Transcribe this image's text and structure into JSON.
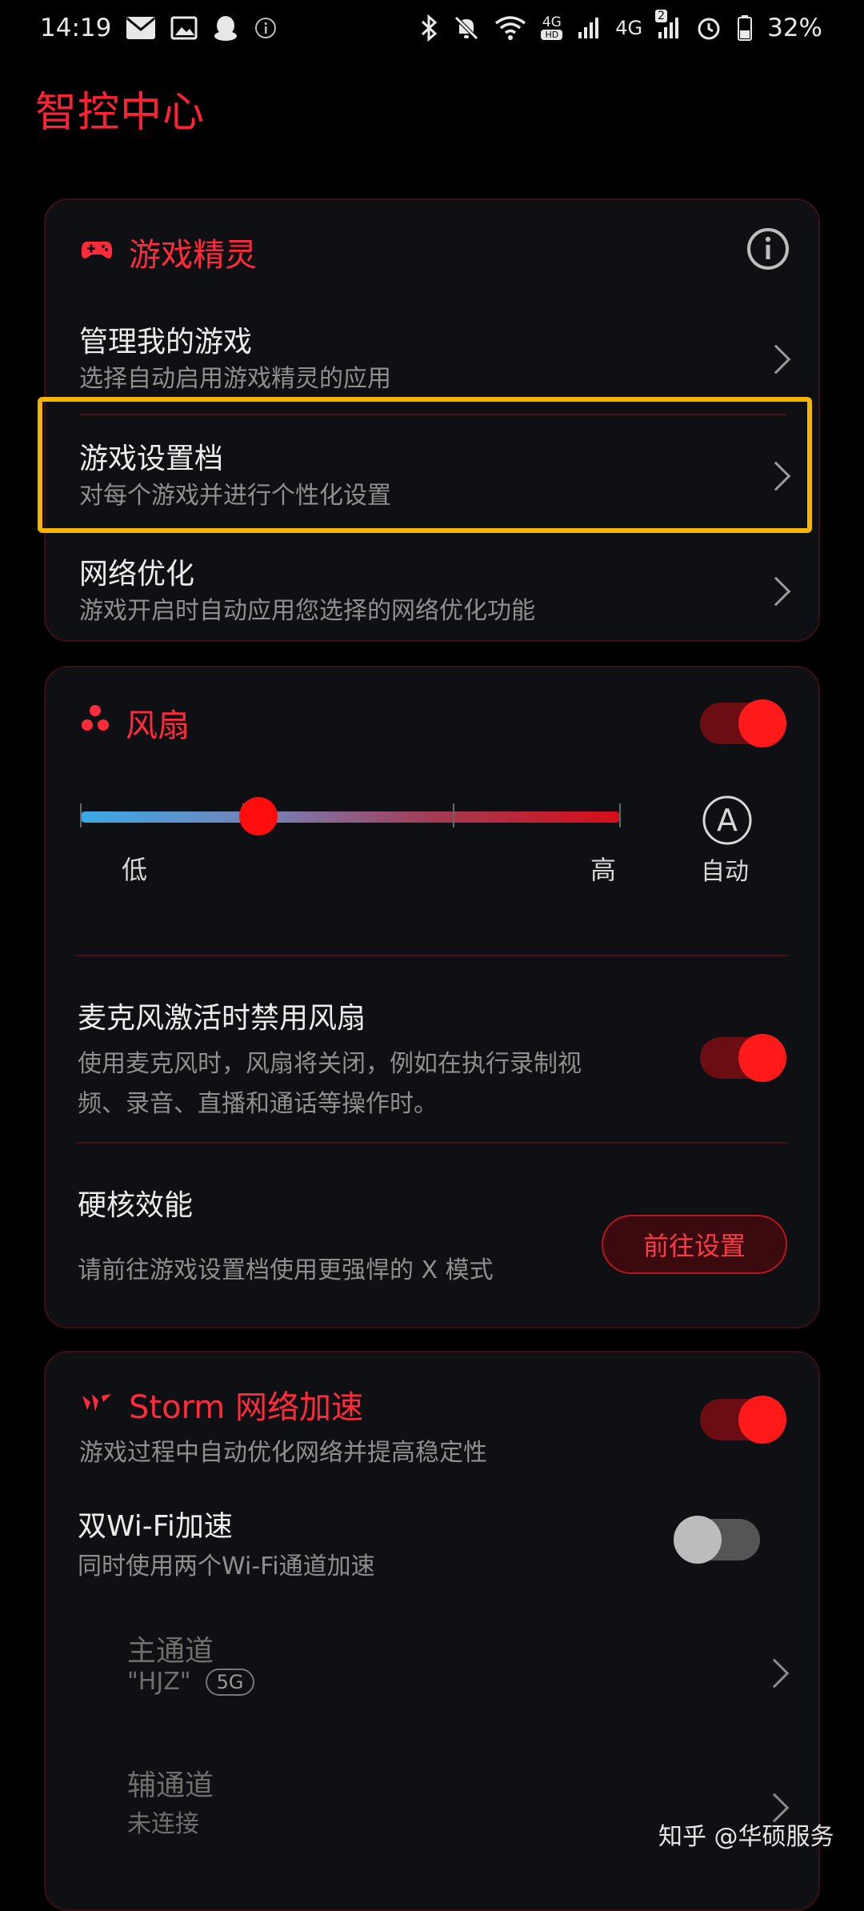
{
  "status_bar": {
    "time": "14:19",
    "net_4g_hd": "4G",
    "net_4g": "4G",
    "sim_badge": "2",
    "battery": "32%",
    "icons_left": [
      "gmail-icon",
      "gallery-icon",
      "qq-icon",
      "info-icon"
    ],
    "icons_right": [
      "bluetooth-icon",
      "mute-icon",
      "wifi-icon",
      "signal-icon",
      "signal-icon",
      "alarm-icon",
      "battery-icon"
    ]
  },
  "page": {
    "title": "智控中心"
  },
  "game_card": {
    "title": "游戏精灵",
    "icon": "gamepad-icon",
    "info_icon": "info-icon",
    "items": [
      {
        "title": "管理我的游戏",
        "subtitle": "选择自动启用游戏精灵的应用"
      },
      {
        "title": "游戏设置档",
        "subtitle": "对每个游戏并进行个性化设置"
      },
      {
        "title": "网络优化",
        "subtitle": "游戏开启时自动应用您选择的网络优化功能"
      }
    ]
  },
  "fan_card": {
    "title": "风扇",
    "icon": "fan-icon",
    "enabled": true,
    "slider": {
      "low_label": "低",
      "high_label": "高",
      "level": 0.33
    },
    "auto": {
      "icon_letter": "A",
      "label": "自动"
    },
    "mic_disable": {
      "title": "麦克风激活时禁用风扇",
      "subtitle_line1": "使用麦克风时，风扇将关闭，例如在执行录制视",
      "subtitle_line2": "频、录音、直播和通话等操作时。",
      "enabled": true
    },
    "hardcore": {
      "title": "硬核效能",
      "subtitle": "请前往游戏设置档使用更强悍的 X 模式",
      "button": "前往设置"
    }
  },
  "storm_card": {
    "title": "Storm 网络加速",
    "icon": "storm-icon",
    "subtitle": "游戏过程中自动优化网络并提高稳定性",
    "enabled": true,
    "dual_wifi": {
      "title": "双Wi-Fi加速",
      "subtitle": "同时使用两个Wi-Fi通道加速",
      "enabled": false
    },
    "primary": {
      "title": "主通道",
      "ssid": "\"HJZ\"",
      "band": "5G"
    },
    "secondary": {
      "title": "辅通道",
      "status": "未连接"
    }
  },
  "watermark": "知乎 @华硕服务"
}
